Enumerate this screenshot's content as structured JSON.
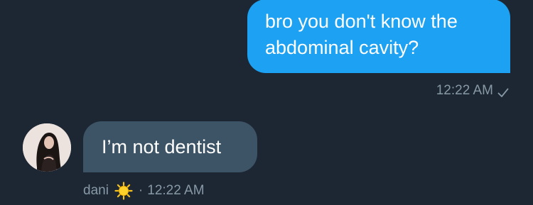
{
  "outgoing": {
    "lines": [
      "bro you don't know the",
      "abdominal cavity?"
    ],
    "time": "12:22 AM",
    "status_icon": "check-icon"
  },
  "incoming": {
    "text": "I’m not dentist",
    "sender": "dani",
    "sender_emoji_icon": "sun-icon",
    "separator": "·",
    "time": "12:22 AM",
    "avatar_icon": "avatar-photo"
  },
  "colors": {
    "background": "#1c2733",
    "outgoing_bubble": "#1da1f2",
    "incoming_bubble": "#3d5466",
    "meta_text": "#8899a6"
  }
}
